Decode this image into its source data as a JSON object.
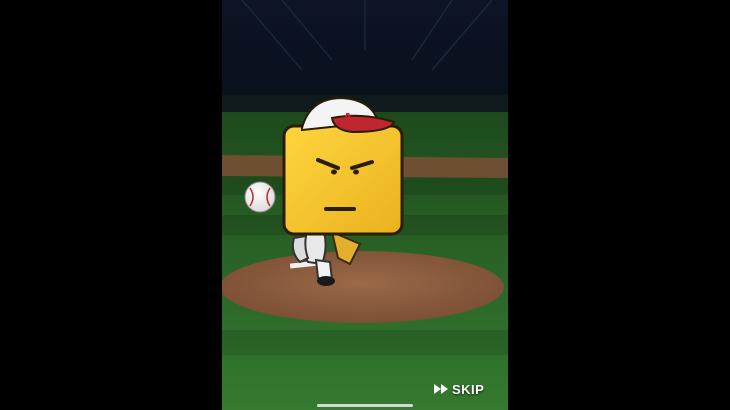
{
  "scene": {
    "description_label": "",
    "cap_letter": "A"
  },
  "controls": {
    "skip_label": "SKIP",
    "skip_icon": "fast-forward-icon"
  },
  "colors": {
    "grass_dark": "#1e4a1c",
    "grass_light": "#2f6b2a",
    "dirt": "#8a5a3c",
    "head_yellow": "#f5c531",
    "cap_red": "#c0262d",
    "sky": "#0a1020"
  }
}
